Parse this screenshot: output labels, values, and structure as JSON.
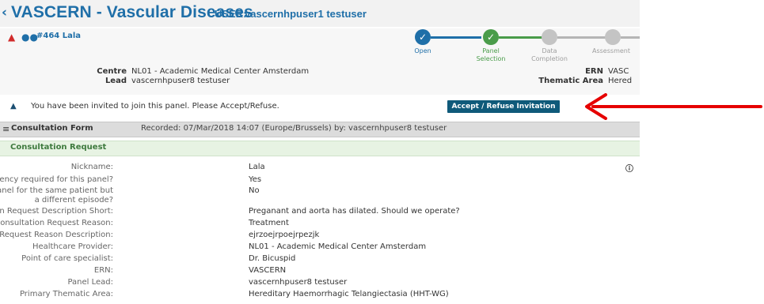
{
  "header": {
    "logo_icon": "case-chevron-icon",
    "title": "VASCERN - Vascular Diseases",
    "user_label": "USER:",
    "user_name": "vascernhpuser1 testuser"
  },
  "case": {
    "warn_icon": "warning-icon",
    "group_icon": "users-icon",
    "id_label": "#464 Lala"
  },
  "stepper": [
    {
      "label": "Open",
      "state": "done",
      "color": "#1f6fa8"
    },
    {
      "label": "Panel Selection",
      "state": "done",
      "color": "#4a9c4a"
    },
    {
      "label": "Data Completion",
      "state": "pending",
      "color": "#9e9e9e"
    },
    {
      "label": "Assessment",
      "state": "pending",
      "color": "#9e9e9e"
    }
  ],
  "centre": {
    "label": "Centre",
    "value": "NL01 - Academic Medical Center Amsterdam"
  },
  "lead": {
    "label": "Lead",
    "value": "vascernhpuser8 testuser"
  },
  "ern": {
    "label": "ERN",
    "value": "VASC"
  },
  "thematic": {
    "label": "Thematic Area",
    "value": "Hered"
  },
  "invitation": {
    "text": "You have been invited to join this panel. Please Accept/Refuse.",
    "button": "Accept / Refuse Invitation"
  },
  "form_bar": {
    "title": "Consultation Form",
    "recorded": "Recorded: 07/Mar/2018 14:07 (Europe/Brussels) by: vascernhpuser8 testuser"
  },
  "request": {
    "title": "Consultation Request",
    "fields": [
      {
        "label": "Nickname:",
        "value": "Lala"
      },
      {
        "label": "Is urgency required for this panel?",
        "value": "Yes"
      },
      {
        "label": "Is this a repeat of a previous panel for the same patient but a different episode?",
        "value": "No"
      },
      {
        "label": "Consultation Request Description Short:",
        "value": "Preganant and aorta has dilated. Should we operate?"
      },
      {
        "label": "Consultation Request Reason:",
        "value": "Treatment"
      },
      {
        "label": "Consultation Request Reason Description:",
        "value": "ejrzoejrpoejrpezjk"
      },
      {
        "label": "Healthcare Provider:",
        "value": "NL01 - Academic Medical Center Amsterdam"
      },
      {
        "label": "Point of care specialist:",
        "value": "Dr. Bicuspid"
      },
      {
        "label": "ERN:",
        "value": "VASCERN"
      },
      {
        "label": "Panel Lead:",
        "value": "vascernhpuser8 testuser"
      },
      {
        "label": "Primary Thematic Area:",
        "value": "Hereditary Haemorrhagic Telangiectasia (HHT-WG)"
      }
    ]
  },
  "annotation": {
    "arrow_color": "#e60000"
  }
}
